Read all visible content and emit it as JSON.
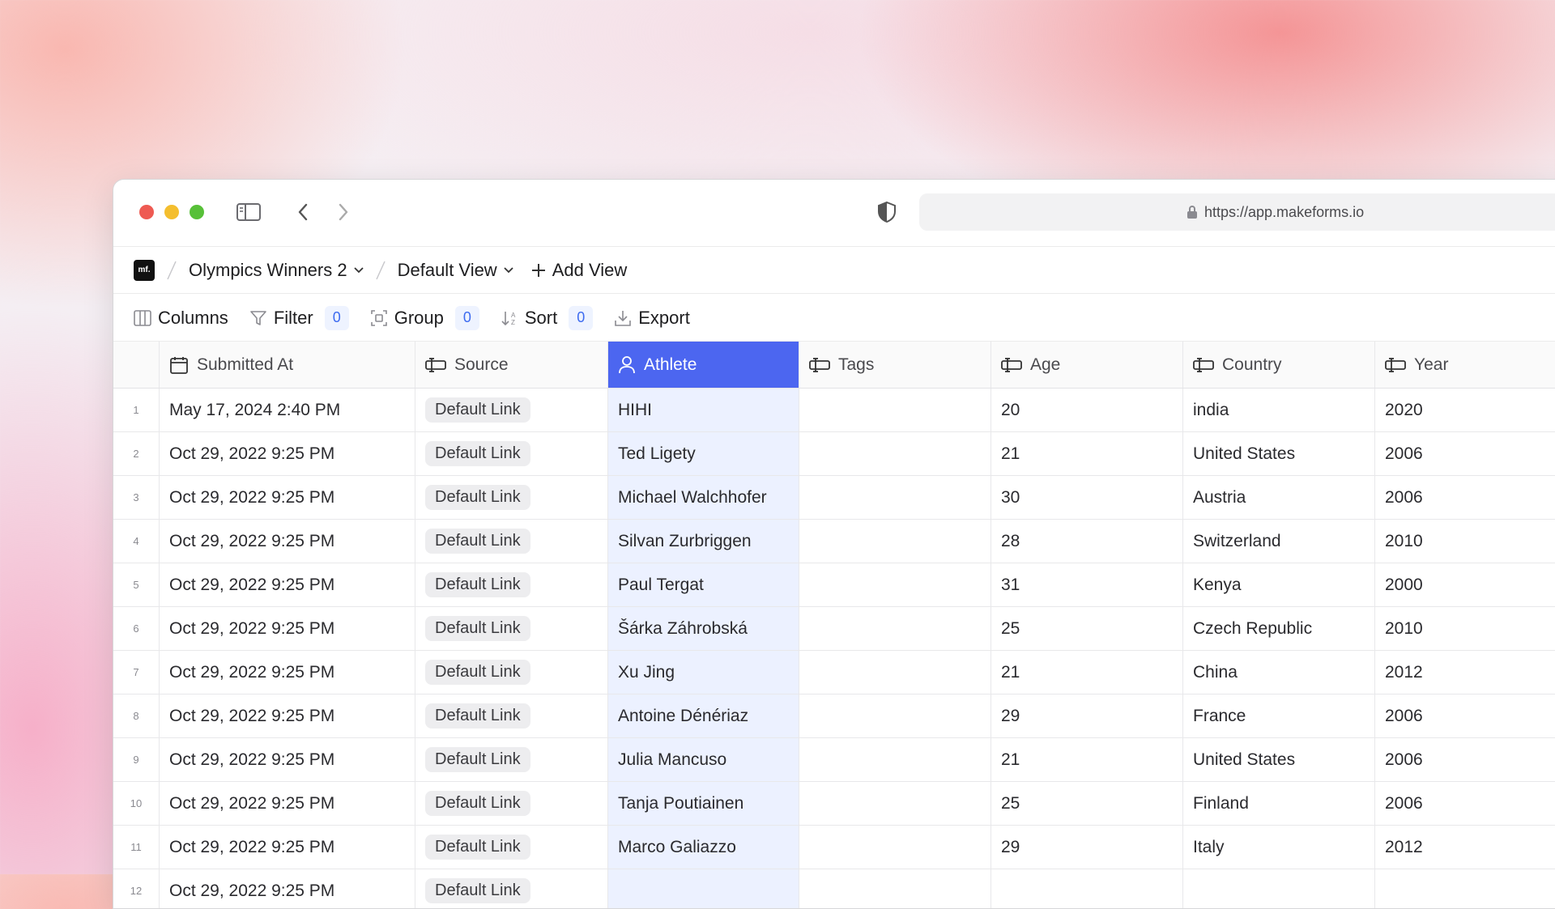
{
  "browser": {
    "url": "https://app.makeforms.io"
  },
  "breadcrumbs": {
    "logo_text": "mf.",
    "form_name": "Olympics Winners 2",
    "view_name": "Default View",
    "add_view_label": "Add View"
  },
  "toolbar": {
    "columns_label": "Columns",
    "filter_label": "Filter",
    "filter_count": "0",
    "group_label": "Group",
    "group_count": "0",
    "sort_label": "Sort",
    "sort_count": "0",
    "export_label": "Export"
  },
  "table": {
    "columns": [
      "Submitted At",
      "Source",
      "Athlete",
      "Tags",
      "Age",
      "Country",
      "Year"
    ],
    "rows": [
      {
        "n": "1",
        "submitted": "May 17, 2024 2:40 PM",
        "source": "Default Link",
        "athlete": "HIHI",
        "tags": "",
        "age": "20",
        "country": "india",
        "year": "2020"
      },
      {
        "n": "2",
        "submitted": "Oct 29, 2022 9:25 PM",
        "source": "Default Link",
        "athlete": "Ted Ligety",
        "tags": "",
        "age": "21",
        "country": "United States",
        "year": "2006"
      },
      {
        "n": "3",
        "submitted": "Oct 29, 2022 9:25 PM",
        "source": "Default Link",
        "athlete": "Michael Walchhofer",
        "tags": "",
        "age": "30",
        "country": "Austria",
        "year": "2006"
      },
      {
        "n": "4",
        "submitted": "Oct 29, 2022 9:25 PM",
        "source": "Default Link",
        "athlete": "Silvan Zurbriggen",
        "tags": "",
        "age": "28",
        "country": "Switzerland",
        "year": "2010"
      },
      {
        "n": "5",
        "submitted": "Oct 29, 2022 9:25 PM",
        "source": "Default Link",
        "athlete": "Paul Tergat",
        "tags": "",
        "age": "31",
        "country": "Kenya",
        "year": "2000"
      },
      {
        "n": "6",
        "submitted": "Oct 29, 2022 9:25 PM",
        "source": "Default Link",
        "athlete": "Šárka Záhrobská",
        "tags": "",
        "age": "25",
        "country": "Czech Republic",
        "year": "2010"
      },
      {
        "n": "7",
        "submitted": "Oct 29, 2022 9:25 PM",
        "source": "Default Link",
        "athlete": "Xu Jing",
        "tags": "",
        "age": "21",
        "country": "China",
        "year": "2012"
      },
      {
        "n": "8",
        "submitted": "Oct 29, 2022 9:25 PM",
        "source": "Default Link",
        "athlete": "Antoine Dénériaz",
        "tags": "",
        "age": "29",
        "country": "France",
        "year": "2006"
      },
      {
        "n": "9",
        "submitted": "Oct 29, 2022 9:25 PM",
        "source": "Default Link",
        "athlete": "Julia Mancuso",
        "tags": "",
        "age": "21",
        "country": "United States",
        "year": "2006"
      },
      {
        "n": "10",
        "submitted": "Oct 29, 2022 9:25 PM",
        "source": "Default Link",
        "athlete": "Tanja Poutiainen",
        "tags": "",
        "age": "25",
        "country": "Finland",
        "year": "2006"
      },
      {
        "n": "11",
        "submitted": "Oct 29, 2022 9:25 PM",
        "source": "Default Link",
        "athlete": "Marco Galiazzo",
        "tags": "",
        "age": "29",
        "country": "Italy",
        "year": "2012"
      },
      {
        "n": "12",
        "submitted": "Oct 29, 2022 9:25 PM",
        "source": "Default Link",
        "athlete": "",
        "tags": "",
        "age": "",
        "country": "",
        "year": ""
      }
    ]
  },
  "colors": {
    "accent": "#4c66f0",
    "selected_column_bg": "#ecf1ff",
    "count_badge_text": "#3d6bf0"
  },
  "icons": {
    "sidebar": "sidebar-icon",
    "back": "chevron-left-icon",
    "forward": "chevron-right-icon",
    "shield": "shield-icon",
    "lock": "lock-icon",
    "calendar": "calendar-icon",
    "text_field": "text-field-icon",
    "person": "person-icon"
  }
}
